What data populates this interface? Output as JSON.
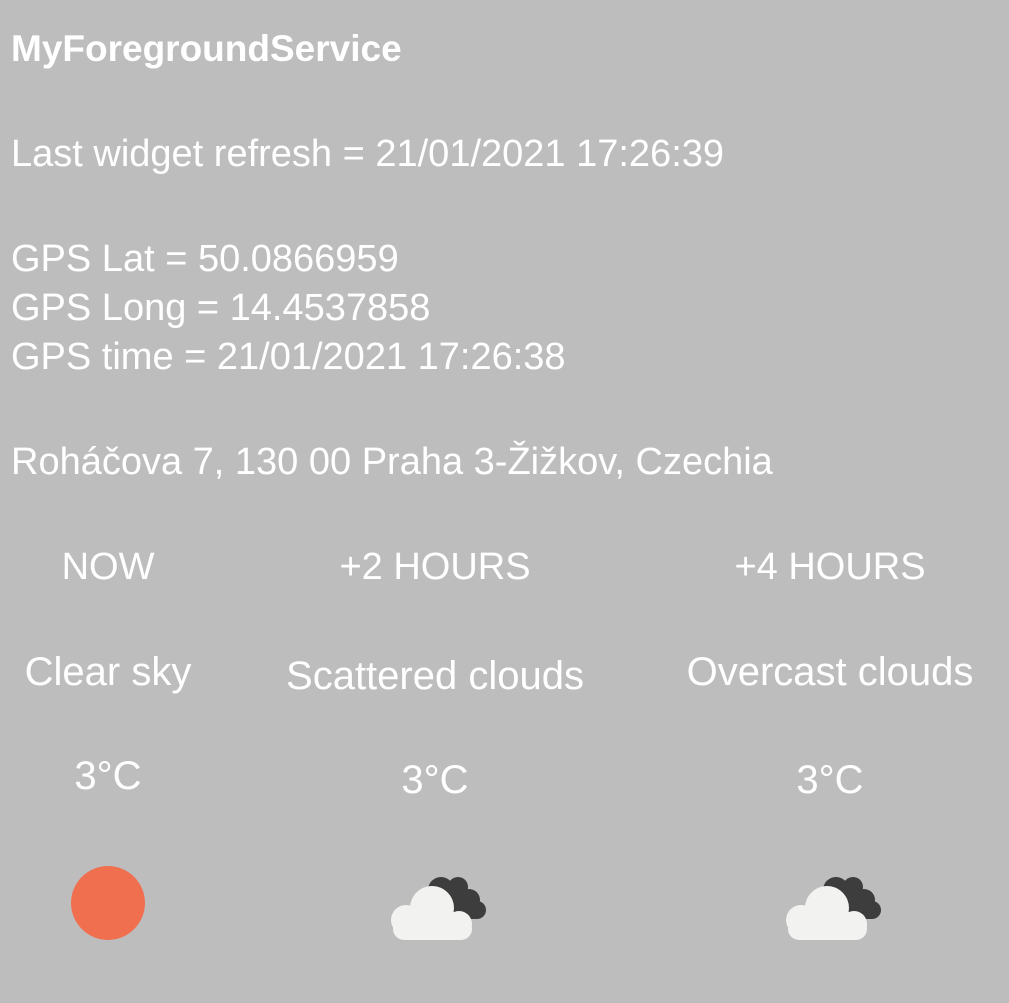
{
  "title": "MyForegroundService",
  "refresh": "Last widget refresh = 21/01/2021 17:26:39",
  "gps": {
    "lat": "GPS Lat = 50.0866959",
    "long": "GPS Long = 14.4537858",
    "time": "GPS time = 21/01/2021 17:26:38"
  },
  "address": "Roháčova 7, 130 00 Praha 3-Žižkov, Czechia",
  "forecast": [
    {
      "period": "NOW",
      "description": "Clear sky",
      "temperature": "3°C",
      "icon": "sun-icon",
      "icon_color": "#ef6f4f"
    },
    {
      "period": "+2 HOURS",
      "description": "Scattered clouds",
      "temperature": "3°C",
      "icon": "scattered-clouds-icon"
    },
    {
      "period": "+4 HOURS",
      "description": "Overcast clouds",
      "temperature": "3°C",
      "icon": "overcast-clouds-icon"
    }
  ],
  "colors": {
    "background": "#bdbdbd",
    "text": "#ffffff",
    "cloud_light": "#f2f2f0",
    "cloud_dark": "#3d3d3d"
  }
}
